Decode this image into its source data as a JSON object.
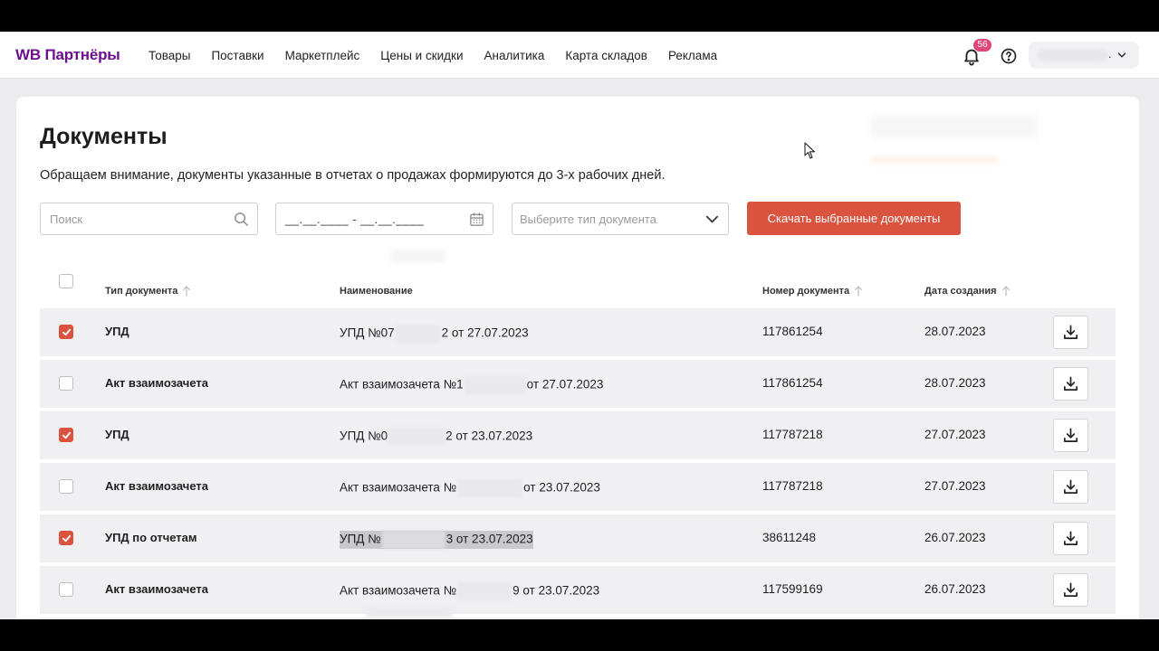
{
  "header": {
    "logo": "WB Партнёры",
    "nav": [
      "Товары",
      "Поставки",
      "Маркетплейс",
      "Цены и скидки",
      "Аналитика",
      "Карта складов",
      "Реклама"
    ],
    "notifications_count": "56",
    "account_suffix": "."
  },
  "page": {
    "title": "Документы",
    "notice": "Обращаем внимание, документы указанные в отчетах о продажах формируются до 3-х рабочих дней."
  },
  "filters": {
    "search_placeholder": "Поиск",
    "date_range": "__.__.____ - __.__.____",
    "type_placeholder": "Выберите тип документа",
    "download_selected": "Скачать выбранные документы"
  },
  "table": {
    "headers": {
      "type": "Тип документа",
      "name": "Наименование",
      "number": "Номер документа",
      "created": "Дата создания"
    },
    "rows": [
      {
        "checked": true,
        "type": "УПД",
        "name_prefix": "УПД №07",
        "name_suffix": "2 от 27.07.2023",
        "number": "117861254",
        "created": "28.07.2023"
      },
      {
        "checked": false,
        "type": "Акт взаимозачета",
        "name_prefix": "Акт взаимозачета №1",
        "name_suffix": "от 27.07.2023",
        "number": "117861254",
        "created": "28.07.2023"
      },
      {
        "checked": true,
        "type": "УПД",
        "name_prefix": "УПД №0",
        "name_suffix": "2 от 23.07.2023",
        "number": "117787218",
        "created": "27.07.2023"
      },
      {
        "checked": false,
        "type": "Акт взаимозачета",
        "name_prefix": "Акт взаимозачета №",
        "name_suffix": "от 23.07.2023",
        "number": "117787218",
        "created": "27.07.2023"
      },
      {
        "checked": true,
        "type": "УПД по отчетам",
        "name_prefix": "УПД №",
        "name_suffix": "3 от 23.07.2023",
        "number": "38611248",
        "created": "26.07.2023"
      },
      {
        "checked": false,
        "type": "Акт взаимозачета",
        "name_prefix": "Акт взаимозачета №",
        "name_suffix": "9 от 23.07.2023",
        "number": "117599169",
        "created": "26.07.2023"
      }
    ]
  },
  "colors": {
    "brand": "#6b0f8e",
    "accent": "#d9533f",
    "badge": "#e0457b"
  },
  "icons": {
    "bell": "bell-icon",
    "help": "help-icon",
    "search": "search-icon",
    "calendar": "calendar-icon",
    "chevron": "chevron-down-icon",
    "download": "download-icon",
    "sort": "sort-arrow-icon"
  }
}
